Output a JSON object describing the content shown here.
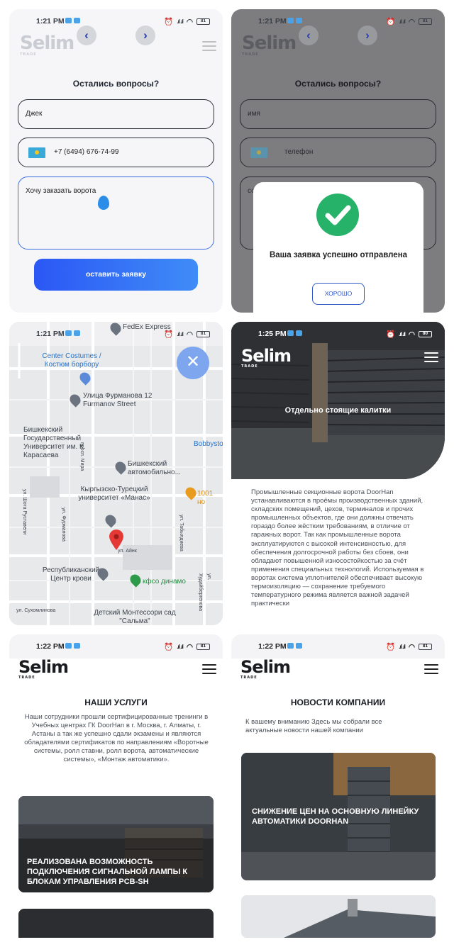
{
  "status": {
    "time_form": "1:21 PM",
    "time_dialog": "1:21 PM",
    "time_map": "1:21 PM",
    "time_hero": "1:25 PM",
    "time_services": "1:22 PM",
    "time_news": "1:22 PM",
    "battery": "81",
    "battery_hero": "80"
  },
  "logo": {
    "name": "Selim",
    "sub": "TRADE"
  },
  "form": {
    "title": "Остались вопросы?",
    "name_value": "Джек",
    "phone_value": "+7 (6494) 676-74-99",
    "message_value": "Хочу заказать ворота",
    "submit_label": "оставить заявку"
  },
  "form_empty": {
    "name_placeholder": "имя",
    "phone_placeholder": "телефон",
    "message_placeholder": "со"
  },
  "dialog": {
    "message": "Ваша заявка успешно отправлена",
    "ok_label": "ХОРОШО"
  },
  "map": {
    "labels": {
      "fedex": "FedEx Express",
      "costumes": "Center Costumes / Костюм борбору",
      "furmanov": "Улица Фурманова 12 Furmanov Street",
      "bishkek_university": "Бишкекский Государственный Университет им. К. Карасаева",
      "bobby": "Bobbysto",
      "auto": "Бишкекский автомобильно...",
      "manas": "Кыргызско-Турецкий университет «Манас»",
      "nights": "1001 но",
      "blood": "Республиканский Центр крови",
      "dinamo": "кфсо динамо",
      "kindergarten": "Детский Монтессори сад \"Сальма\"",
      "st_mira": "просп. Мира",
      "st_furmanova": "ул. Фурманова",
      "st_aynik": "ул. Айнк",
      "st_tabyldieva": "ул. Табылдиева",
      "st_rotavleva": "ул. Шота Руставели",
      "st_suhomlinova": "ул. Сухомлинова",
      "st_khudaybergenova": "ул. Худайбергенова"
    }
  },
  "hero": {
    "title": "Отдельно стоящие калитки",
    "text": "Промышленные секционные ворота DoorHan устанавливаются в проёмы производственных зданий, складских помещений, цехов, терминалов и прочих промышленных объектов, где они должны отвечать гораздо более жёстким требованиям, в отличие от гаражных ворот. Так как промышленные ворота эксплуатируются с высокой интенсивностью, для обеспечения долгосрочной работы без сбоев, они обладают повышенной износостойкостью за счёт применения специальных технологий. Используемая в воротах система уплотнителей обеспечивает высокую термоизоляцию — сохранение требуемого температурного режима является важной задачей практически"
  },
  "services": {
    "title": "НАШИ УСЛУГИ",
    "text": "Наши сотрудники прошли сертифицированные тренинги в Учебных центрах ГК DoorHan в г. Москва, г. Алматы, г. Астаны а так же успешно сдали экзамены и являются обладателями сертификатов по направлениям «Воротные системы, ролл ставни, ролл ворота, автоматические системы», «Монтаж автоматики».",
    "card_title": "РЕАЛИЗОВАНА ВОЗМОЖНОСТЬ ПОДКЛЮЧЕНИЯ СИГНАЛЬНОЙ ЛАМПЫ К БЛОКАМ УПРАВЛЕНИЯ PCB-SH"
  },
  "news": {
    "title": "НОВОСТИ КОМПАНИИ",
    "text": "К вашему вниманию Здесь мы собрали все актуальные новости нашей компании",
    "card_title": "СНИЖЕНИЕ ЦЕН НА ОСНОВНУЮ ЛИНЕЙКУ АВТОМАТИКИ DOORHAN"
  },
  "icons": [
    "back-arrow-icon",
    "forward-arrow-icon",
    "menu-icon",
    "kz-flag-icon",
    "checkmark-icon",
    "close-icon",
    "map-pin-icon",
    "battery-icon",
    "wifi-icon",
    "signal-icon"
  ],
  "colors": {
    "accent": "#2b57f5",
    "success": "#27b26a",
    "map_close": "#7da6ee",
    "pin_red": "#e53935"
  }
}
